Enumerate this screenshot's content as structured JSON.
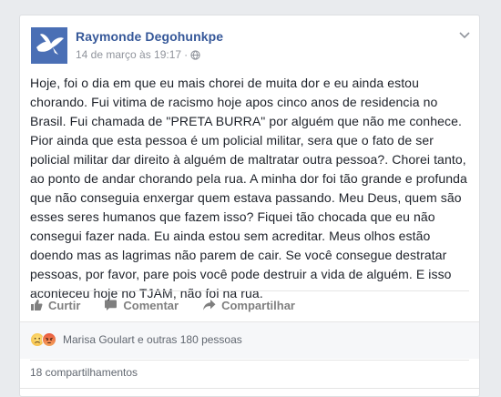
{
  "post": {
    "author": "Raymonde Degohunkpe",
    "timestamp": "14 de março às 19:17",
    "privacy_separator": "·",
    "privacy_icon": "globe-icon",
    "text": "Hoje, foi o dia em que eu mais chorei de muita dor e eu ainda estou chorando. Fui vitima de racismo hoje apos cinco anos de residencia no Brasil. Fui chamada de \"PRETA BURRA\" por alguém que não me conhece. Pior ainda que esta pessoa é um policial militar, sera que o fato de ser policial militar dar direito à alguém de maltratar outra pessoa?. Chorei tanto, ao ponto de andar chorando pela rua. A minha dor foi tão grande e profunda que não conseguia enxergar quem estava passando. Meu Deus, quem são esses seres humanos que fazem isso? Fiquei tão chocada que eu não consegui fazer nada. Eu ainda estou sem acreditar. Meus olhos estão doendo mas as lagrimas não parem de cair. Se você consegue destratar pessoas, por favor, pare pois você pode destruir a vida de alguém. E isso aconteceu hoje no TJAM, não foi na rua."
  },
  "actions": {
    "like_label": "Curtir",
    "comment_label": "Comentar",
    "share_label": "Compartilhar"
  },
  "reactions": {
    "summary": "Marisa Goulart e outras 180 pessoas",
    "icons": [
      "sad-reaction-icon",
      "angry-reaction-icon"
    ]
  },
  "shares": {
    "count_text": "18 compartilhamentos"
  },
  "colors": {
    "author_link": "#365899",
    "avatar_bg": "#3b5998",
    "sad": "#f7c948",
    "angry": "#e9573e"
  }
}
